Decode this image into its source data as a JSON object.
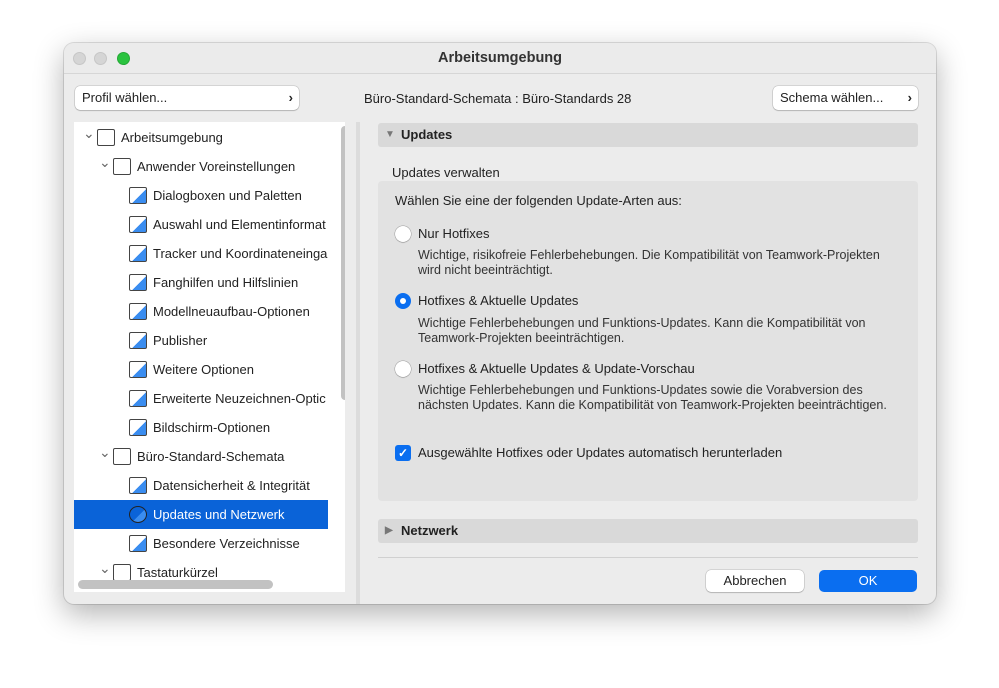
{
  "window": {
    "title": "Arbeitsumgebung"
  },
  "toolbar": {
    "profile_button": "Profil wählen...",
    "scheme_label": "Büro-Standard-Schemata :",
    "scheme_value": "Büro-Standards 28",
    "scheme_button": "Schema wählen..."
  },
  "tree": {
    "items": [
      {
        "label": "Arbeitsumgebung",
        "level": 0,
        "expanded": true
      },
      {
        "label": "Anwender Voreinstellungen",
        "level": 1,
        "expanded": true
      },
      {
        "label": "Dialogboxen und Paletten",
        "level": 2
      },
      {
        "label": "Auswahl und Elementinformat",
        "level": 2
      },
      {
        "label": "Tracker und Koordinateneinga",
        "level": 2
      },
      {
        "label": "Fanghilfen und Hilfslinien",
        "level": 2
      },
      {
        "label": "Modellneuaufbau-Optionen",
        "level": 2
      },
      {
        "label": "Publisher",
        "level": 2
      },
      {
        "label": "Weitere Optionen",
        "level": 2
      },
      {
        "label": "Erweiterte Neuzeichnen-Optic",
        "level": 2
      },
      {
        "label": "Bildschirm-Optionen",
        "level": 2
      },
      {
        "label": "Büro-Standard-Schemata",
        "level": 1,
        "expanded": true
      },
      {
        "label": "Datensicherheit & Integrität",
        "level": 2
      },
      {
        "label": "Updates und Netzwerk",
        "level": 2,
        "selected": true
      },
      {
        "label": "Besondere Verzeichnisse",
        "level": 2
      },
      {
        "label": "Tastaturkürzel",
        "level": 1,
        "expanded": true
      }
    ]
  },
  "updates": {
    "header": "Updates",
    "group_label": "Updates verwalten",
    "prompt": "Wählen Sie eine der folgenden Update-Arten aus:",
    "options": [
      {
        "label": "Nur Hotfixes",
        "desc": "Wichtige, risikofreie Fehlerbehebungen. Die Kompatibilität von Teamwork-Projekten wird nicht beeinträchtigt.",
        "selected": false
      },
      {
        "label": "Hotfixes & Aktuelle Updates",
        "desc": "Wichtige Fehlerbehebungen und Funktions-Updates. Kann die Kompatibilität von Teamwork-Projekten beeinträchtigen.",
        "selected": true
      },
      {
        "label": "Hotfixes & Aktuelle Updates & Update-Vorschau",
        "desc": "Wichtige Fehlerbehebungen und Funktions-Updates sowie die Vorabversion des nächsten Updates. Kann die Kompatibilität von Teamwork-Projekten beeinträchtigen.",
        "selected": false
      }
    ],
    "auto_download": {
      "label": "Ausgewählte Hotfixes oder Updates automatisch herunterladen",
      "checked": true
    }
  },
  "network": {
    "header": "Netzwerk"
  },
  "footer": {
    "cancel": "Abbrechen",
    "ok": "OK"
  },
  "colors": {
    "accent": "#0a6ef0",
    "selection": "#0a63d8",
    "close": "#d5d5d5",
    "maximize": "#2ac33f"
  }
}
